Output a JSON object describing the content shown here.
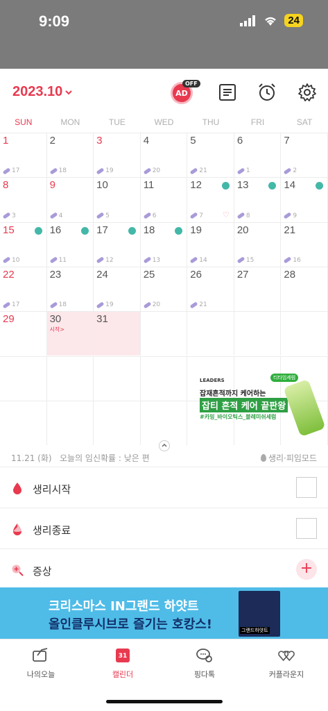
{
  "status": {
    "time": "9:09",
    "battery": "24"
  },
  "header": {
    "month": "2023.10",
    "ad_label": "AD",
    "ad_state": "OFF"
  },
  "weekdays": [
    "SUN",
    "MON",
    "TUE",
    "WED",
    "THU",
    "FRI",
    "SAT"
  ],
  "calendar": {
    "weeks": [
      [
        {
          "day": "1",
          "pill": "17",
          "red": true
        },
        {
          "day": "2",
          "pill": "18"
        },
        {
          "day": "3",
          "pill": "19",
          "red": true
        },
        {
          "day": "4",
          "pill": "20"
        },
        {
          "day": "5",
          "pill": "21"
        },
        {
          "day": "6",
          "pill": "1"
        },
        {
          "day": "7",
          "pill": "2"
        }
      ],
      [
        {
          "day": "8",
          "pill": "3",
          "red": true
        },
        {
          "day": "9",
          "pill": "4",
          "red": true
        },
        {
          "day": "10",
          "pill": "5"
        },
        {
          "day": "11",
          "pill": "6"
        },
        {
          "day": "12",
          "pill": "7",
          "mark": true,
          "heart": true
        },
        {
          "day": "13",
          "pill": "8",
          "mark": true
        },
        {
          "day": "14",
          "pill": "9",
          "mark": true
        }
      ],
      [
        {
          "day": "15",
          "pill": "10",
          "red": true,
          "mark": true
        },
        {
          "day": "16",
          "pill": "11",
          "mark": true
        },
        {
          "day": "17",
          "pill": "12",
          "mark": true
        },
        {
          "day": "18",
          "pill": "13",
          "mark": true
        },
        {
          "day": "19",
          "pill": "14"
        },
        {
          "day": "20",
          "pill": "15"
        },
        {
          "day": "21",
          "pill": "16"
        }
      ],
      [
        {
          "day": "22",
          "pill": "17",
          "red": true
        },
        {
          "day": "23",
          "pill": "18"
        },
        {
          "day": "24",
          "pill": "19"
        },
        {
          "day": "25",
          "pill": "20"
        },
        {
          "day": "26",
          "pill": "21"
        },
        {
          "day": "27"
        },
        {
          "day": "28"
        }
      ],
      [
        {
          "day": "29",
          "red": true
        },
        {
          "day": "30",
          "period": true,
          "start": "시작>"
        },
        {
          "day": "31",
          "period": true
        },
        {
          "day": ""
        },
        {
          "day": ""
        },
        {
          "day": ""
        },
        {
          "day": ""
        }
      ],
      [
        {
          "day": ""
        },
        {
          "day": ""
        },
        {
          "day": ""
        },
        {
          "day": ""
        },
        {
          "day": ""
        },
        {
          "day": ""
        },
        {
          "day": ""
        }
      ],
      [
        {
          "day": ""
        },
        {
          "day": ""
        },
        {
          "day": ""
        },
        {
          "day": ""
        },
        {
          "day": ""
        },
        {
          "day": ""
        },
        {
          "day": ""
        }
      ]
    ]
  },
  "ad": {
    "brand": "LEADERS",
    "tag": "티타임세럼",
    "line1": "잡재흔적까지 케어하는",
    "line2": "잡티 흔적 케어 끝판왕",
    "line3": "#카밍_바이오틱스_블레미쉬세럼"
  },
  "info": {
    "date": "11.21 (화)",
    "probability": "오늘의 임신확률 : 낮은 편",
    "mode": "생리·피임모드"
  },
  "rows": {
    "period_start": "생리시작",
    "period_end": "생리종료",
    "symptoms": "증상"
  },
  "banner": {
    "line1": "크리스마스 IN그랜드 하얏트",
    "line2": "올인클루시브로 즐기는 호캉스!",
    "image_label": "그랜드하얏트"
  },
  "tabs": [
    {
      "label": "나의오늘",
      "icon": "today-icon"
    },
    {
      "label": "캘린더",
      "icon": "calendar-icon",
      "active": true,
      "icon_text": "31"
    },
    {
      "label": "핑다톡",
      "icon": "chat-icon"
    },
    {
      "label": "커플라운지",
      "icon": "couple-hearts-icon"
    }
  ],
  "colors": {
    "accent": "#e8394f",
    "pill": "#a99bd9",
    "mark": "#43b8a8",
    "banner": "#4fbce8"
  }
}
